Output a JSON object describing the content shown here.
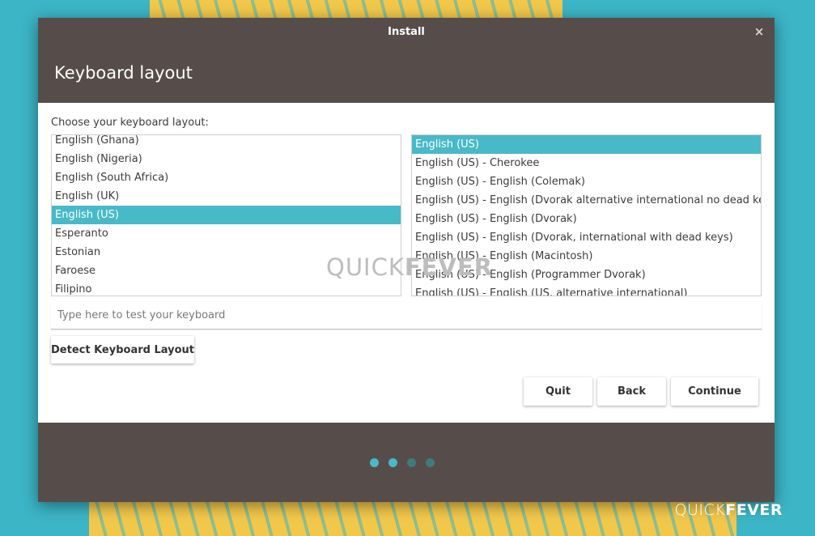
{
  "window": {
    "title": "Install",
    "close_glyph": "×",
    "page_title": "Keyboard layout"
  },
  "main": {
    "prompt": "Choose your keyboard layout:",
    "layouts": [
      {
        "label": "English (Ghana)",
        "selected": false
      },
      {
        "label": "English (Nigeria)",
        "selected": false
      },
      {
        "label": "English (South Africa)",
        "selected": false
      },
      {
        "label": "English (UK)",
        "selected": false
      },
      {
        "label": "English (US)",
        "selected": true
      },
      {
        "label": "Esperanto",
        "selected": false
      },
      {
        "label": "Estonian",
        "selected": false
      },
      {
        "label": "Faroese",
        "selected": false
      },
      {
        "label": "Filipino",
        "selected": false
      }
    ],
    "variants": [
      {
        "label": "English (US)",
        "selected": true
      },
      {
        "label": "English (US) - Cherokee",
        "selected": false
      },
      {
        "label": "English (US) - English (Colemak)",
        "selected": false
      },
      {
        "label": "English (US) - English (Dvorak alternative international no dead keys)",
        "selected": false
      },
      {
        "label": "English (US) - English (Dvorak)",
        "selected": false
      },
      {
        "label": "English (US) - English (Dvorak, international with dead keys)",
        "selected": false
      },
      {
        "label": "English (US) - English (Macintosh)",
        "selected": false
      },
      {
        "label": "English (US) - English (Programmer Dvorak)",
        "selected": false
      },
      {
        "label": "English (US) - English (US, alternative international)",
        "selected": false
      }
    ],
    "test_input": {
      "placeholder": "Type here to test your keyboard",
      "value": ""
    },
    "detect_button_label": "Detect Keyboard Layout"
  },
  "actions": {
    "quit_label": "Quit",
    "back_label": "Back",
    "continue_label": "Continue"
  },
  "watermark": {
    "light_part": "QUICK",
    "bold_part": "FEVER"
  },
  "progress": {
    "total_steps": 4,
    "current_step": 2,
    "active_color": "#48b9c7",
    "inactive_color": "#3f7a7f"
  },
  "colors": {
    "accent": "#48b9c7",
    "header_bg": "#564d4a",
    "desktop_bg": "#3cb5c6"
  }
}
